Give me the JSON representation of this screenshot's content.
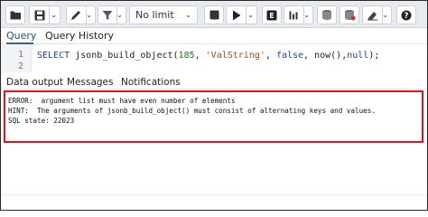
{
  "toolbar": {
    "limit_select": {
      "value": "No limit"
    },
    "icons": [
      "folder-icon",
      "save-icon",
      "pen-icon",
      "filter-icon",
      "stop-icon",
      "play-icon",
      "explain-icon",
      "explain-analyze-icon",
      "commit-icon",
      "rollback-icon",
      "clear-icon",
      "help-icon"
    ]
  },
  "query_tabs": [
    {
      "label": "Query",
      "active": true
    },
    {
      "label": "Query History",
      "active": false
    }
  ],
  "editor": {
    "line_numbers": [
      "1",
      "2"
    ],
    "tokens": {
      "keyword": "SELECT",
      "fn": " jsonb_build_object(",
      "n1": "185",
      "c1": ", ",
      "s1": "'ValString'",
      "c2": ", ",
      "kw2": "false",
      "c3": ", now(),",
      "kw3": "null",
      "end": ");"
    }
  },
  "output_tabs": [
    {
      "label": "Data output"
    },
    {
      "label": "Messages"
    },
    {
      "label": "Notifications"
    }
  ],
  "messages": {
    "line1": "ERROR:  argument list must have even number of elements",
    "line2": "HINT:  The arguments of jsonb_build_object() must consist of alternating keys and values.",
    "line3": "SQL state: 22023"
  },
  "colors": {
    "error_border": "#e0151b",
    "keyword": "#1a3fc4",
    "string": "#b9440f",
    "number": "#1a7d1a",
    "tab_active": "#326690"
  }
}
